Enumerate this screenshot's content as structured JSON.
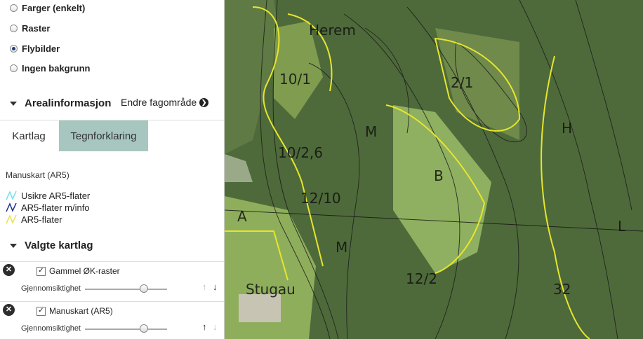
{
  "background_options": [
    {
      "label": "Farger (enkelt)",
      "checked": false
    },
    {
      "label": "Raster",
      "checked": false
    },
    {
      "label": "Flybilder",
      "checked": true
    },
    {
      "label": "Ingen bakgrunn",
      "checked": false
    }
  ],
  "areal": {
    "title": "Arealinformasjon",
    "endre_label": "Endre fagområde"
  },
  "tabs": [
    {
      "label": "Kartlag",
      "active": false
    },
    {
      "label": "Tegnforklaring",
      "active": true
    }
  ],
  "legend": {
    "title": "Manuskart (AR5)",
    "items": [
      {
        "label": "Usikre AR5-flater",
        "color": "#6fe0e8"
      },
      {
        "label": "AR5-flater m/info",
        "color": "#1a2a8c"
      },
      {
        "label": "AR5-flater",
        "color": "#e8e04a"
      }
    ]
  },
  "selected_layers": {
    "title": "Valgte kartlag",
    "opacity_label": "Gjennomsiktighet",
    "layers": [
      {
        "name": "Gammel ØK-raster",
        "checked": true,
        "opacity": 0.72
      },
      {
        "name": "Manuskart (AR5)",
        "checked": true,
        "opacity": 0.72
      }
    ]
  },
  "map": {
    "labels": [
      "Herem",
      "10/1",
      "2/1",
      "H",
      "L",
      "M",
      "B",
      "10/2,6",
      "12/10",
      "A",
      "M",
      "12/2",
      "Stugau",
      "32"
    ],
    "colors": {
      "aerial": "#4e6a3a",
      "field": "#8fb060",
      "yellow": "#e6e52e"
    }
  }
}
